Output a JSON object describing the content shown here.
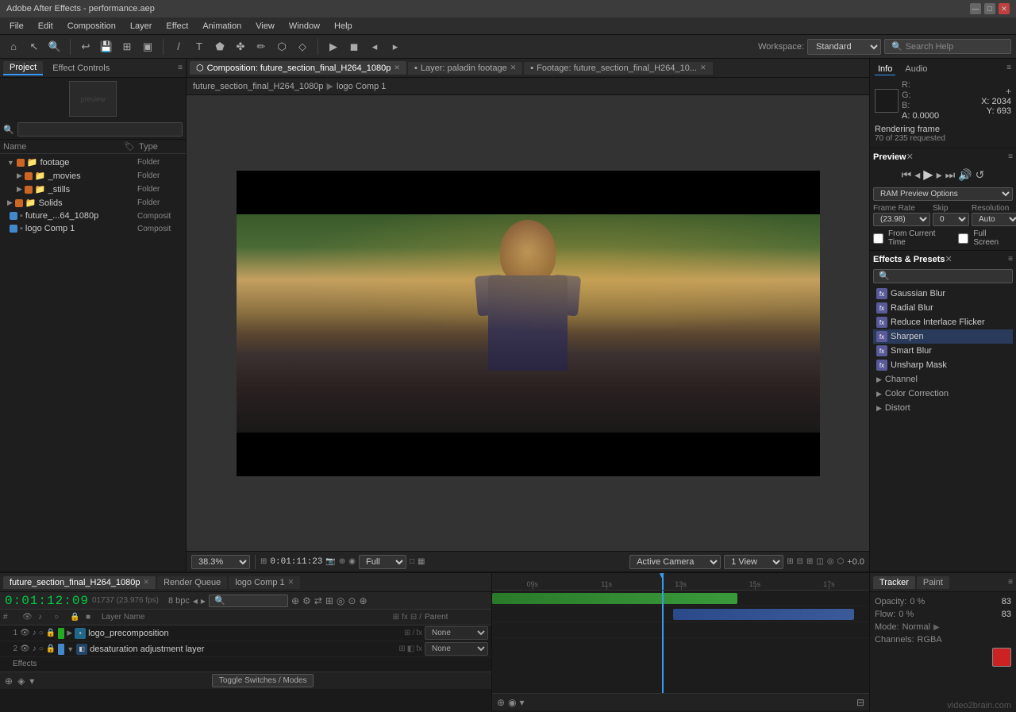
{
  "app": {
    "title": "Adobe After Effects - performance.aep",
    "title_icon": "★"
  },
  "titlebar": {
    "minimize": "—",
    "maximize": "□",
    "close": "✕"
  },
  "menu": {
    "items": [
      "File",
      "Edit",
      "Composition",
      "Layer",
      "Effect",
      "Animation",
      "View",
      "Window",
      "Help"
    ]
  },
  "toolbar": {
    "workspace_label": "Workspace:",
    "workspace_value": "Standard",
    "search_placeholder": "Search Help"
  },
  "project_panel": {
    "tab": "Project",
    "effect_controls_tab": "Effect Controls",
    "thumbnail_placeholder": "",
    "search_placeholder": "🔍",
    "columns": {
      "name": "Name",
      "type": "Type"
    },
    "items": [
      {
        "level": 0,
        "expand": true,
        "icon": "📁",
        "color": "#cc6622",
        "name": "footage",
        "type": "Folder"
      },
      {
        "level": 1,
        "expand": false,
        "icon": "📁",
        "color": "#cc6622",
        "name": "_movies",
        "type": "Folder"
      },
      {
        "level": 1,
        "expand": false,
        "icon": "📁",
        "color": "#cc6622",
        "name": "_stills",
        "type": "Folder"
      },
      {
        "level": 0,
        "expand": false,
        "icon": "📁",
        "color": "#cc6622",
        "name": "Solids",
        "type": "Folder"
      },
      {
        "level": 0,
        "expand": false,
        "icon": "▪",
        "color": "#4488cc",
        "name": "future_...64_1080p",
        "type": "Composit"
      },
      {
        "level": 0,
        "expand": false,
        "icon": "▪",
        "color": "#4488cc",
        "name": "logo Comp 1",
        "type": "Composit"
      }
    ]
  },
  "comp_panel": {
    "tabs": [
      {
        "label": "Composition: future_section_final_H264_1080p",
        "active": true,
        "closeable": true
      },
      {
        "label": "Layer: paladin footage",
        "active": false,
        "closeable": true
      },
      {
        "label": "Footage: future_section_final_H264_10...",
        "active": false,
        "closeable": true
      }
    ],
    "breadcrumbs": [
      "future_section_final_H264_1080p",
      "logo Comp 1"
    ],
    "canvas": {
      "zoom": "38.3%",
      "timecode": "0:01:11:23",
      "quality": "Full",
      "view": "Active Camera",
      "view_option": "1 View",
      "plus_minus": "+0.0"
    }
  },
  "info_panel": {
    "tab_info": "Info",
    "tab_audio": "Audio",
    "color": "#1a1a1a",
    "r": "R:",
    "g": "G:",
    "b": "B:",
    "a": "A: 0.0000",
    "x": "X: 2034",
    "y": "Y: 693",
    "crosshair": "+",
    "rendering": "Rendering frame",
    "rendering_sub": "70 of 235 requested"
  },
  "preview_panel": {
    "title": "Preview",
    "close": "✕",
    "ram_preview_label": "RAM Preview Options",
    "frame_rate_label": "Frame Rate",
    "frame_rate_value": "(23.98)",
    "skip_label": "Skip",
    "skip_value": "0",
    "resolution_label": "Resolution",
    "resolution_value": "Auto",
    "from_current_label": "From Current Time",
    "full_screen_label": "Full Screen"
  },
  "effects_panel": {
    "title": "Effects & Presets",
    "close": "✕",
    "search_placeholder": "🔍",
    "items": [
      {
        "name": "Gaussian Blur",
        "selected": false
      },
      {
        "name": "Radial Blur",
        "selected": false
      },
      {
        "name": "Reduce Interlace Flicker",
        "selected": false
      },
      {
        "name": "Sharpen",
        "selected": true
      },
      {
        "name": "Smart Blur",
        "selected": false
      },
      {
        "name": "Unsharp Mask",
        "selected": false
      }
    ],
    "categories": [
      {
        "name": "Channel",
        "expanded": false
      },
      {
        "name": "Color Correction",
        "expanded": false
      },
      {
        "name": "Distort",
        "expanded": false
      }
    ]
  },
  "timeline": {
    "tabs": [
      {
        "label": "future_section_final_H264_1080p",
        "active": true,
        "closeable": true
      },
      {
        "label": "Render Queue",
        "active": false
      },
      {
        "label": "logo Comp 1",
        "active": false,
        "closeable": true
      }
    ],
    "timecode": "0:01:12:09",
    "fps": "01737 (23.976 fps)",
    "bit_depth": "8 bpc",
    "search_placeholder": "🔍",
    "layers": [
      {
        "num": "1",
        "name": "logo_precomposition",
        "color": "#22aa22",
        "has_fx": false,
        "parent": "None",
        "type": "comp"
      },
      {
        "num": "2",
        "name": "desaturation adjustment layer",
        "color": "#4488cc",
        "has_fx": true,
        "parent": "None",
        "type": "adj"
      }
    ],
    "ruler_marks": [
      "09s",
      "11s",
      "13s",
      "15s",
      "17s"
    ],
    "toggle_switches_btn": "Toggle Switches / Modes",
    "bottom_icons": [
      "▾",
      "⊕",
      "◉"
    ]
  },
  "tracker_panel": {
    "tracker_tab": "Tracker",
    "paint_tab": "Paint",
    "opacity_label": "Opacity:",
    "opacity_val": "0 %",
    "opacity_num": "83",
    "flow_label": "Flow:",
    "flow_val": "0 %",
    "flow_num": "83",
    "mode_label": "Mode:",
    "mode_val": "Normal",
    "channels_label": "Channels:",
    "channels_val": "RGBA"
  },
  "watermark": "video2brain.com"
}
